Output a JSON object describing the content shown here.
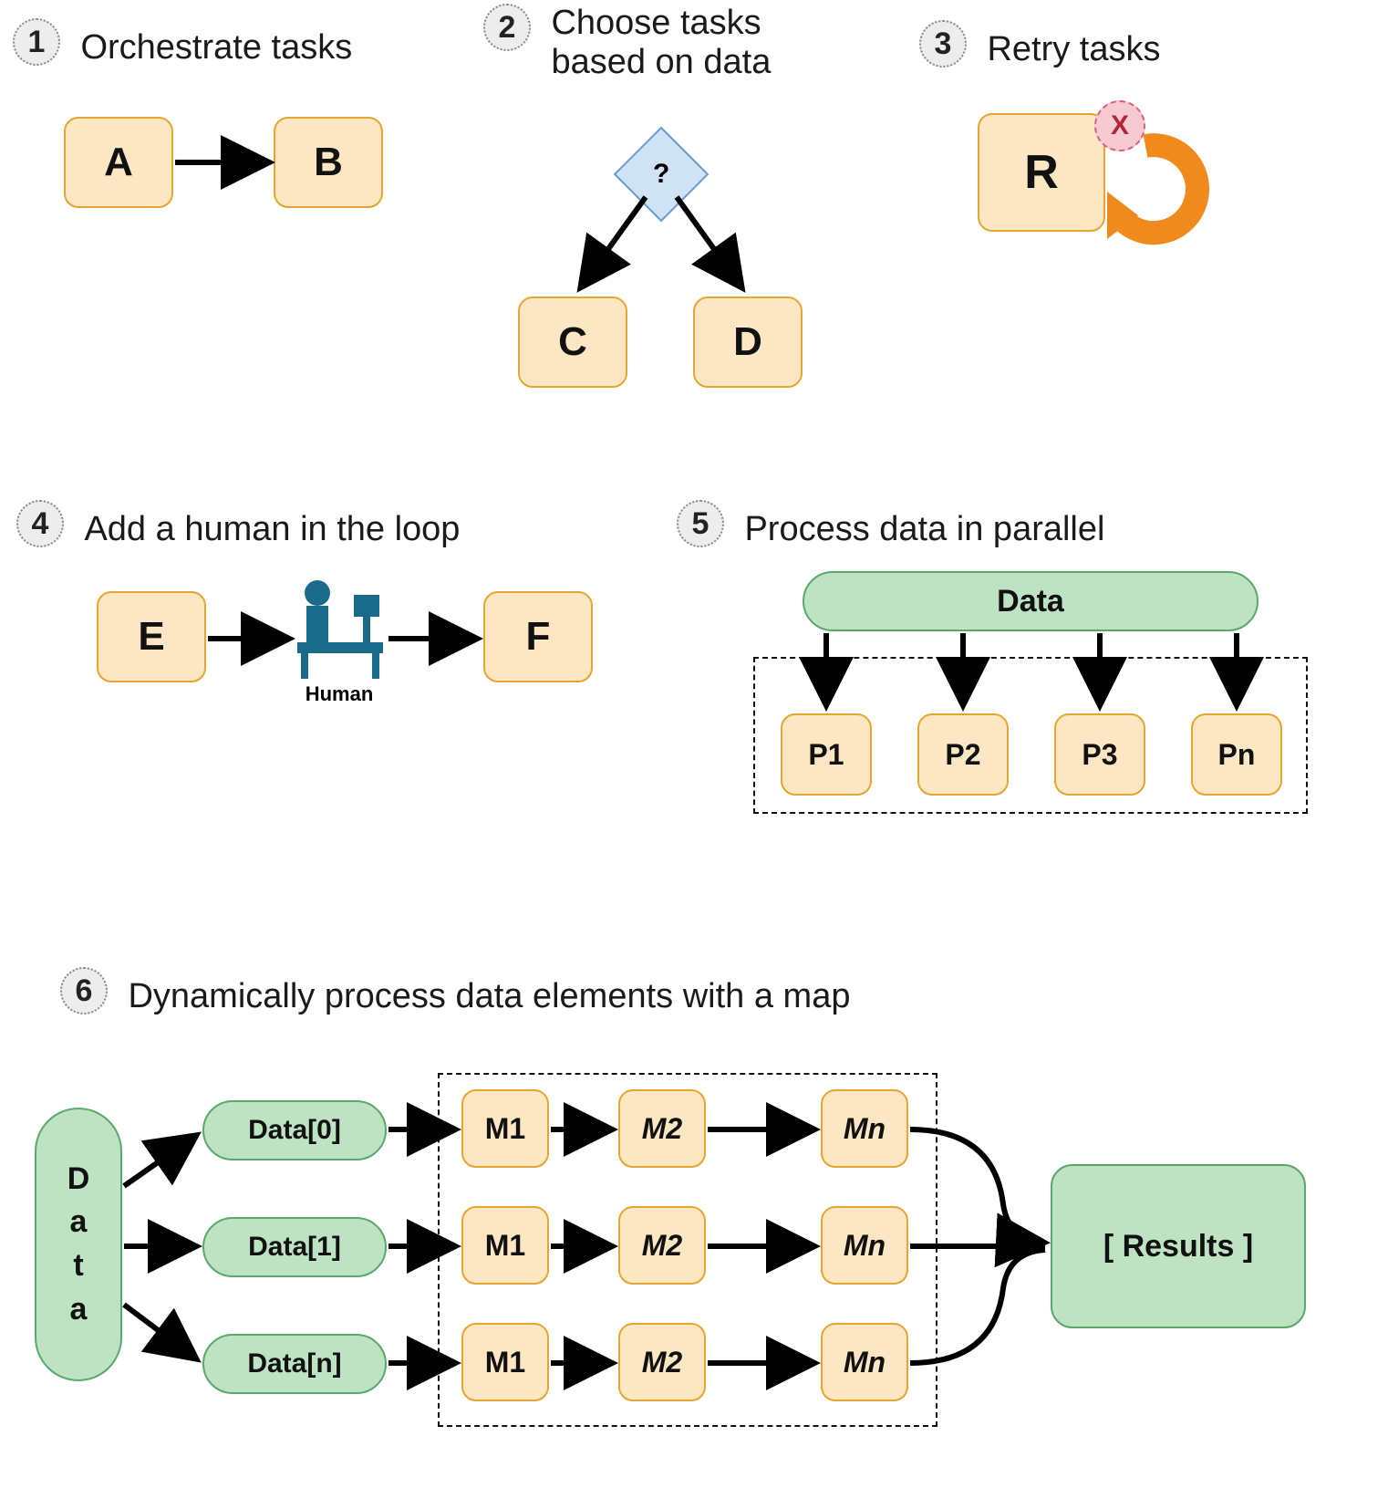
{
  "sections": {
    "s1": {
      "num": "1",
      "title": "Orchestrate tasks",
      "nodes": {
        "a": "A",
        "b": "B"
      }
    },
    "s2": {
      "num": "2",
      "title": "Choose tasks based on data",
      "decision": "?",
      "nodes": {
        "c": "C",
        "d": "D"
      }
    },
    "s3": {
      "num": "3",
      "title": "Retry tasks",
      "nodes": {
        "r": "R"
      },
      "fail": "X"
    },
    "s4": {
      "num": "4",
      "title": "Add a human in the loop",
      "nodes": {
        "e": "E",
        "f": "F"
      },
      "human_label": "Human"
    },
    "s5": {
      "num": "5",
      "title": "Process data in parallel",
      "data": "Data",
      "nodes": {
        "p1": "P1",
        "p2": "P2",
        "p3": "P3",
        "pn": "Pn"
      }
    },
    "s6": {
      "num": "6",
      "title": "Dynamically process data elements with a map",
      "data": "D\na\nt\na",
      "rows": [
        "Data[0]",
        "Data[1]",
        "Data[n]"
      ],
      "cols": [
        "M1",
        "M2",
        "Mn"
      ],
      "results": "[ Results ]"
    }
  }
}
